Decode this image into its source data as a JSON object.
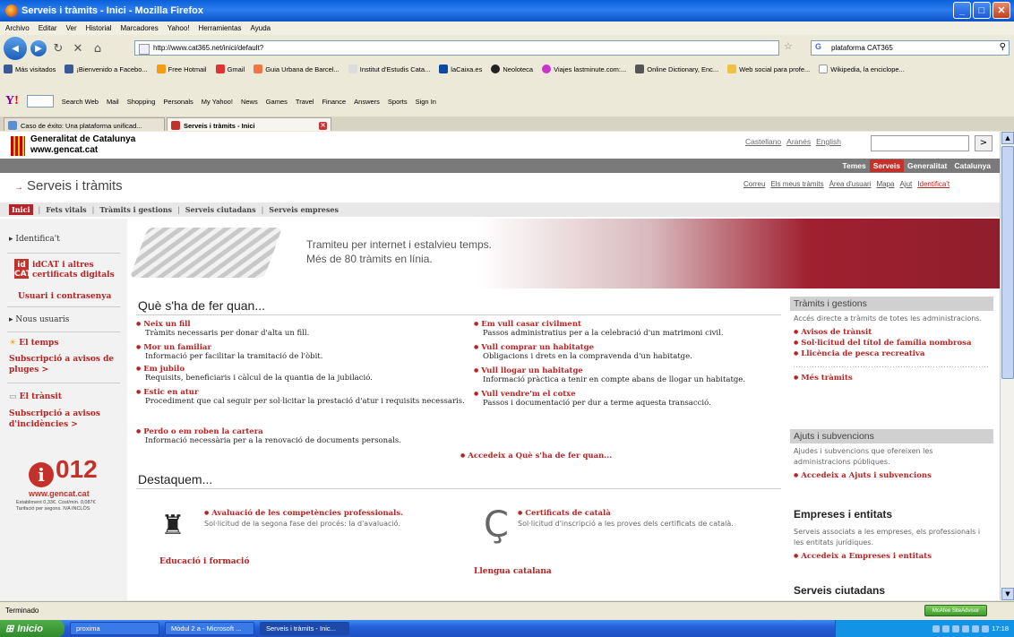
{
  "window": {
    "title": "Serveis i tràmits - Inici - Mozilla Firefox"
  },
  "menu": [
    "Archivo",
    "Editar",
    "Ver",
    "Historial",
    "Marcadores",
    "Yahoo!",
    "Herramientas",
    "Ayuda"
  ],
  "nav": {
    "url": "http://www.cat365.net/inici/default?",
    "search_value": "plataforma CAT365"
  },
  "bookmarks": [
    "Más visitados",
    "¡Bienvenido a Facebo...",
    "Free Hotmail",
    "Gmail",
    "Guia Urbana de Barcel...",
    "Institut d'Estudis Cata...",
    "laCaixa.es",
    "Neoloteca",
    "Viajes lastminute.com:...",
    "Online Dictionary, Enc...",
    "Web social para profe...",
    "Wikipedia, la enciclope..."
  ],
  "yahoo_toolbar": [
    "Search Web",
    "Mail",
    "Shopping",
    "Personals",
    "My Yahoo!",
    "News",
    "Games",
    "Travel",
    "Finance",
    "Answers",
    "Sports",
    "Sign In"
  ],
  "tabs": [
    {
      "label": "Caso de éxito: Una plataforma unificad..."
    },
    {
      "label": "Serveis i tràmits - Inici"
    }
  ],
  "header": {
    "org_line1": "Generalitat de Catalunya",
    "org_line2": "www.gencat.cat",
    "langs": [
      "Castellano",
      "Aranés",
      "English"
    ],
    "search_go": ">",
    "topnav": [
      "Temes",
      "Serveis",
      "Generalitat",
      "Catalunya"
    ]
  },
  "section": {
    "title": "Serveis i tràmits",
    "links": [
      "Correu",
      "Els meus tràmits",
      "Àrea d'usuari",
      "Mapa",
      "Ajut",
      "Identifica't"
    ],
    "subnav": [
      "Inici",
      "Fets vitals",
      "Tràmits i gestions",
      "Serveis ciutadans",
      "Serveis empreses"
    ]
  },
  "sidebar": {
    "identificat": "Identifica't",
    "idcat_logo": "id CAT",
    "idcat": "idCAT i altres certificats digitals",
    "idcat_l1": "idCAT i altres",
    "idcat_l2": "certificats digitals",
    "usuari": "Usuari i contrasenya",
    "nous": "Nous usuaris",
    "temps_title": "El temps",
    "temps_link_l1": "Subscripció a avisos de",
    "temps_link_l2": "pluges >",
    "transit_title": "El trànsit",
    "transit_link_l1": "Subscripció a avisos",
    "transit_link_l2": "d'incidències >",
    "logo_num": "012",
    "logo_url": "www.gencat.cat",
    "logo_fine1": "Establiment 0,33€. Cost/min. 0,087€",
    "logo_fine2": "Tarifació per segons. IVA INCLÒS"
  },
  "banner": {
    "line1": "Tramiteu per internet i estalvieu temps.",
    "line2": "Més de 80 tràmits en línia."
  },
  "que_fer": {
    "heading": "Què s'ha de fer quan...",
    "left": [
      {
        "title": "Neix un fill",
        "desc": "Tràmits necessaris per donar d'alta un fill."
      },
      {
        "title": "Mor un familiar",
        "desc": "Informació per facilitar la tramitació de l'òbit."
      },
      {
        "title": "Em jubilo",
        "desc": "Requisits, beneficiaris i càlcul de la quantia de la jubilació."
      },
      {
        "title": "Estic en atur",
        "desc": "Procediment que cal seguir per sol·licitar la prestació d'atur i requisits necessaris."
      },
      {
        "title": "Perdo o em roben la cartera",
        "desc": "Informació necessària per a la renovació de documents personals."
      }
    ],
    "right": [
      {
        "title": "Em vull casar civilment",
        "desc": "Passos administratius per a la celebració d'un matrimoni civil."
      },
      {
        "title": "Vull comprar un habitatge",
        "desc": "Obligacions i drets en la compravenda d'un habitatge."
      },
      {
        "title": "Vull llogar un habitatge",
        "desc": "Informació pràctica a tenir en compte abans de llogar un habitatge."
      },
      {
        "title": "Vull vendre'm el cotxe",
        "desc": "Passos i documentació per dur a terme aquesta transacció."
      }
    ],
    "more": "Accedeix a Què s'ha de fer quan..."
  },
  "destaquem": {
    "heading": "Destaquem...",
    "items": [
      {
        "title": "Avaluació de les competències professionals.",
        "desc": "Sol·licitud de la segona fase del procés: la d'avaluació.",
        "category": "Educació i formació"
      },
      {
        "title": "Certificats de català",
        "desc": "Sol·licitud d'inscripció a les proves dels certificats de català.",
        "category": "Llengua catalana"
      }
    ]
  },
  "right_boxes": {
    "tramits": {
      "title": "Tràmits i gestions",
      "desc": "Accés directe a tràmits de totes les administracions.",
      "links": [
        "Avisos de trànsit",
        "Sol·licitud del títol de família nombrosa",
        "Llicència de pesca recreativa"
      ],
      "more": "Més tràmits"
    },
    "ajuts": {
      "title": "Ajuts i subvencions",
      "desc": "Ajudes i subvencions que ofereixen les administracions públiques.",
      "more": "Accedeix a Ajuts i subvencions"
    },
    "empreses": {
      "title": "Empreses i entitats",
      "desc": "Serveis associats a les empreses, els professionals i les entitats jurídiques.",
      "more": "Accedeix a Empreses i entitats"
    },
    "ciutadans": {
      "title": "Serveis ciutadans"
    }
  },
  "status": {
    "text": "Terminado",
    "mcafee": "McAfee SiteAdvisor"
  },
  "taskbar": {
    "start": "Inicio",
    "buttons": [
      "proxima",
      "Mòdul 2 a - Microsoft ...",
      "Serveis i tràmits - Inic..."
    ],
    "clock": "17:18"
  }
}
